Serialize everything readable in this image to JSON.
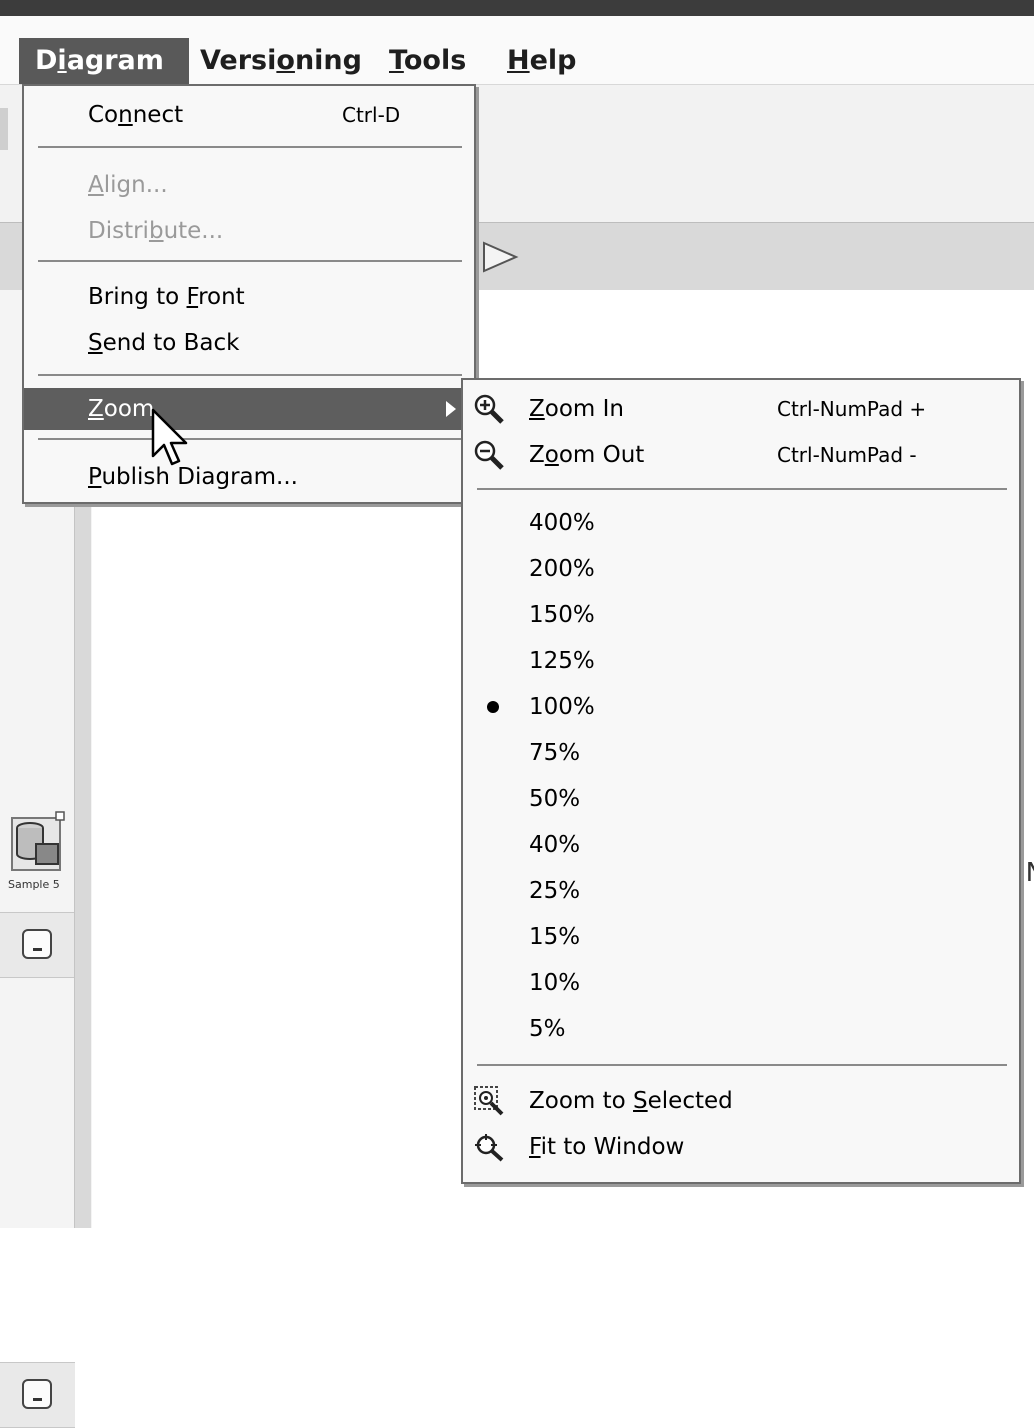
{
  "menubar": {
    "items": [
      {
        "pre": "D",
        "ul": "i",
        "post": "agram"
      },
      {
        "pre": "Versi",
        "ul": "o",
        "post": "ning"
      },
      {
        "pre": "",
        "ul": "T",
        "post": "ools"
      },
      {
        "pre": "",
        "ul": "H",
        "post": "elp"
      }
    ]
  },
  "diagram_menu": {
    "connect": {
      "pre": "Co",
      "ul": "n",
      "post": "nect",
      "shortcut": "Ctrl-D"
    },
    "align": {
      "pre": "",
      "ul": "A",
      "post": "lign..."
    },
    "distribute": {
      "pre": "Distri",
      "ul": "b",
      "post": "ute..."
    },
    "bring_to_front": {
      "pre": "Bring to ",
      "ul": "F",
      "post": "ront"
    },
    "send_to_back": {
      "pre": "",
      "ul": "S",
      "post": "end to Back"
    },
    "zoom": {
      "pre": "",
      "ul": "Z",
      "post": "oom"
    },
    "publish": {
      "pre": "",
      "ul": "P",
      "post": "ublish Diagram..."
    }
  },
  "zoom_menu": {
    "zoom_in": {
      "pre": "",
      "ul": "Z",
      "post": "oom In",
      "shortcut": "Ctrl-NumPad +"
    },
    "zoom_out": {
      "pre": "Z",
      "ul": "o",
      "post": "om Out",
      "shortcut": "Ctrl-NumPad -"
    },
    "levels": [
      "400%",
      "200%",
      "150%",
      "125%",
      "100%",
      "75%",
      "50%",
      "40%",
      "25%",
      "15%",
      "10%",
      "5%"
    ],
    "selected_level": "100%",
    "zoom_to_selected": {
      "pre": "Zoom to ",
      "ul": "S",
      "post": "elected"
    },
    "fit_to_window": {
      "pre": "",
      "ul": "F",
      "post": "it to Window"
    }
  },
  "background": {
    "icon_label": "Sample 5",
    "canvas_text_fragment": "IN"
  },
  "icons": {
    "zoom_in": "zoom-in-icon",
    "zoom_out": "zoom-out-icon",
    "zoom_to_selected": "zoom-to-selected-icon",
    "fit_to_window": "fit-to-window-icon",
    "submenu_arrow": "chevron-right-icon",
    "cursor": "mouse-pointer-icon"
  }
}
